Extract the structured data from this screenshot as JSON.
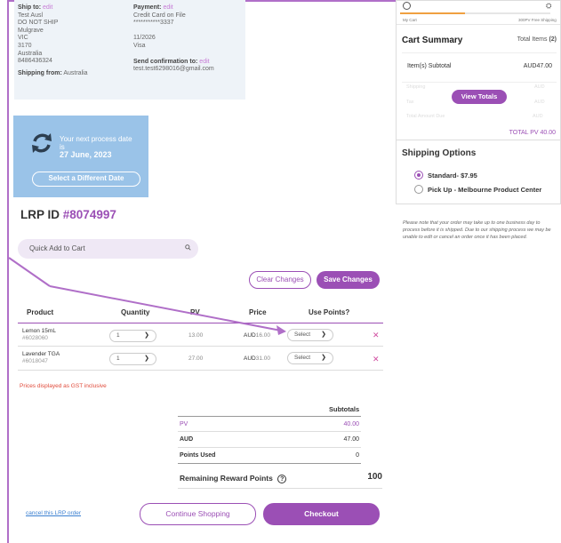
{
  "order_info": {
    "ship_to_label": "Ship to:",
    "ship_to_edit": "edit",
    "ship_to_lines": [
      "Test Ausl",
      "DO NOT SHIP",
      "Mulgrave",
      "VIC",
      "3170",
      "Australia",
      "8486436324"
    ],
    "payment_label": "Payment:",
    "payment_edit": "edit",
    "payment_lines": [
      "Credit Card on File",
      "***********3337",
      "",
      "11/2026",
      "Visa"
    ],
    "confirmation_label": "Send confirmation to:",
    "confirmation_edit": "edit",
    "confirmation_email": "test.test6298016@gmail.com",
    "shipping_from_label": "Shipping from:",
    "shipping_from_value": "Australia"
  },
  "process": {
    "line1": "Your next process date",
    "line2": "is",
    "date": "27 June, 2023",
    "button": "Select a Different Date"
  },
  "lrp": {
    "label": "LRP ID",
    "id": "#8074997"
  },
  "quick_add": {
    "placeholder": "Quick Add to Cart"
  },
  "buttons": {
    "clear": "Clear Changes",
    "save": "Save Changes",
    "continue": "Continue Shopping",
    "checkout": "Checkout",
    "cancel": "cancel this LRP order"
  },
  "table": {
    "headers": [
      "Product",
      "Quantity",
      "PV",
      "Price",
      "Use Points?"
    ],
    "rows": [
      {
        "name": "Lemon 15mL",
        "sku": "#6028060",
        "qty": "1",
        "pv": "13.00",
        "currency": "AUD",
        "price": "16.00",
        "points": "Select"
      },
      {
        "name": "Lavender TGA",
        "sku": "#6018047",
        "qty": "1",
        "pv": "27.00",
        "currency": "AUD",
        "price": "31.00",
        "points": "Select"
      }
    ]
  },
  "gst_note": "Prices displayed as GST inclusive",
  "subtotals": {
    "title": "Subtotals",
    "pv_label": "PV",
    "pv_value": "40.00",
    "aud_label": "AUD",
    "aud_value": "47.00",
    "points_label": "Points Used",
    "points_value": "0",
    "remaining_label": "Remaining Reward Points",
    "remaining_value": "100"
  },
  "cart": {
    "my_cart": "My Cart",
    "free_shipping": "300PV Free Shipping",
    "progress_fraction": 0.43,
    "title": "Cart Summary",
    "total_items_label": "Total Items",
    "total_items_value": "(2)",
    "subtotal_label": "Item(s) Subtotal",
    "subtotal_value": "AUD47.00",
    "shipping_label": "Shipping",
    "shipping_value": "AUD",
    "tax_label": "Tax",
    "tax_value": "AUD",
    "total_due_label": "Total Amount Due",
    "total_due_value": "AUD",
    "view_totals": "View Totals",
    "total_pv": "TOTAL PV 40.00"
  },
  "shipping_options": {
    "title": "Shipping Options",
    "options": [
      {
        "label": "Standard- $7.95",
        "selected": true
      },
      {
        "label": "Pick Up - Melbourne Product Center",
        "selected": false
      }
    ]
  },
  "note": "Please note that your order may take up to one business day to process before it is shipped. Due to our shipping process we may be unable to edit or cancel an order once it has been placed.",
  "colors": {
    "accent": "#9b4fb5",
    "process_bg": "#9ac3e8",
    "warning": "#e04a3a"
  }
}
